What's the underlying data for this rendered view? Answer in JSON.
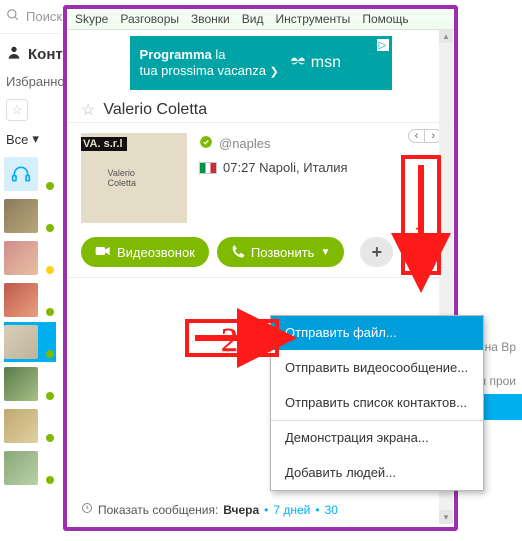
{
  "left": {
    "search_placeholder": "Поиск",
    "contacts_label": "Контакты",
    "favorites_label": "Избранное",
    "all_label": "Все"
  },
  "right_bg": {
    "line1": "я на Вр",
    "line2": "ки прои"
  },
  "menubar": [
    "Skype",
    "Разговоры",
    "Звонки",
    "Вид",
    "Инструменты",
    "Помощь"
  ],
  "ad": {
    "line1_bold": "Programma",
    "line1_rest": " la",
    "line2": "tua prossima vacanza",
    "brand": "msn"
  },
  "contact": {
    "name": "Valerio Coletta",
    "handle": "@naples",
    "location": "07:27 Napoli, Италия",
    "pic_corner": "VA. s.r.l",
    "pic_center": "Valerio Coletta"
  },
  "actions": {
    "video": "Видеозвонок",
    "call": "Позвонить",
    "plus": "+"
  },
  "dropdown": {
    "send_file": "Отправить файл...",
    "send_video": "Отправить видеосообщение...",
    "send_contacts": "Отправить список контактов...",
    "screen_share": "Демонстрация экрана...",
    "add_people": "Добавить людей..."
  },
  "history": {
    "label": "Показать сообщения:",
    "yesterday": "Вчера",
    "days7": "7 дней",
    "days30": "30"
  },
  "annotations": {
    "n1": "1",
    "n2": "2"
  }
}
